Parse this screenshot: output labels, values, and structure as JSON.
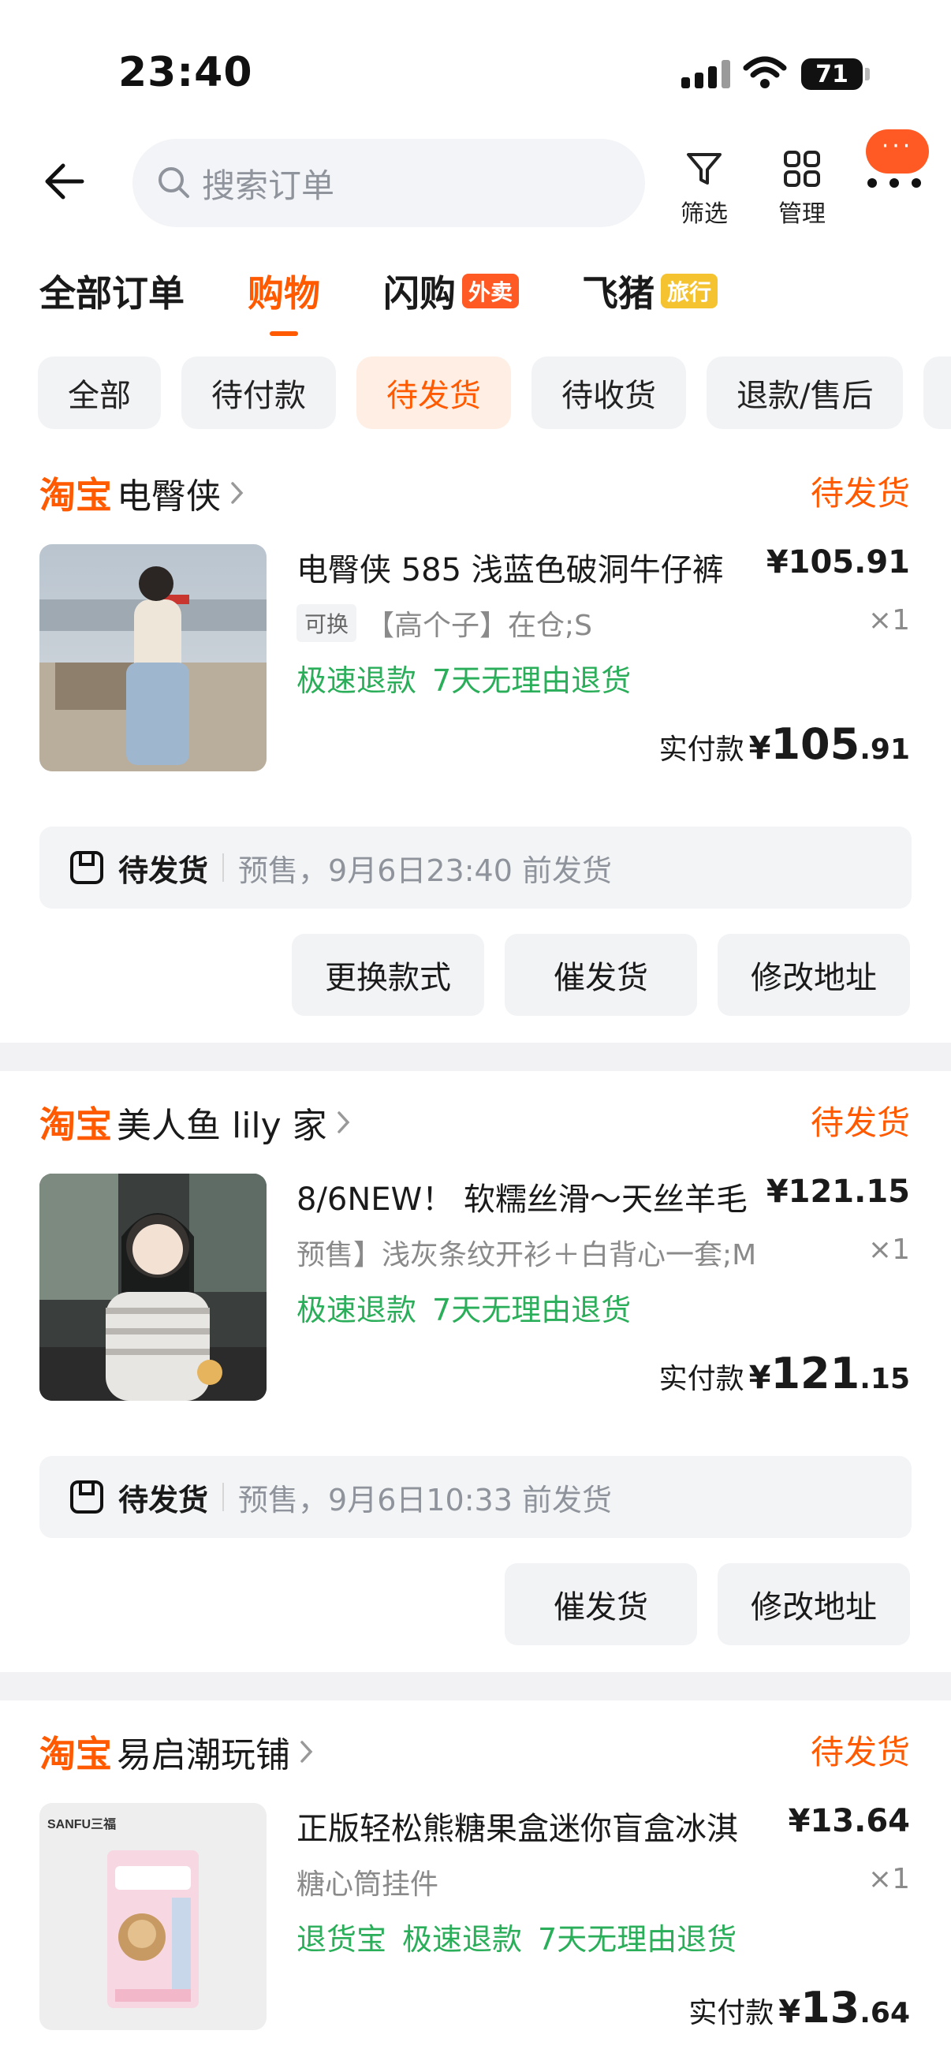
{
  "status_bar": {
    "time": "23:40",
    "battery": "71"
  },
  "header": {
    "search_placeholder": "搜索订单",
    "filter_label": "筛选",
    "manage_label": "管理",
    "more_bubble": "···"
  },
  "tabs": [
    {
      "label": "全部订单",
      "tag": ""
    },
    {
      "label": "购物",
      "tag": ""
    },
    {
      "label": "闪购",
      "tag": "外卖"
    },
    {
      "label": "飞猪",
      "tag": "旅行"
    }
  ],
  "filters": [
    "全部",
    "待付款",
    "待发货",
    "待收货",
    "退款/售后"
  ],
  "active_filter": "待发货",
  "colors": {
    "accent": "#ff5a00",
    "green": "#2aae59"
  },
  "orders": [
    {
      "platform": "淘宝",
      "shop": "电臀侠",
      "status": "待发货",
      "title": "电臀侠 585 浅蓝色破洞牛仔裤",
      "price": "¥105.91",
      "sku_badge": "可换",
      "sku": "【高个子】在仓;S",
      "qty": "×1",
      "benefits": [
        "极速退款",
        "7天无理由退货"
      ],
      "paid_label": "实付款",
      "paid_currency": "¥",
      "paid_int": "105",
      "paid_dec": ".91",
      "ship_status": "待发货",
      "ship_text": "预售，9月6日23:40 前发货",
      "buttons": [
        "更换款式",
        "催发货",
        "修改地址"
      ]
    },
    {
      "platform": "淘宝",
      "shop": "美人鱼 lily 家",
      "status": "待发货",
      "title": "8/6NEW！ 软糯丝滑～天丝羊毛",
      "price": "¥121.15",
      "sku_badge": "",
      "sku": "预售】浅灰条纹开衫＋白背心一套;M",
      "qty": "×1",
      "benefits": [
        "极速退款",
        "7天无理由退货"
      ],
      "paid_label": "实付款",
      "paid_currency": "¥",
      "paid_int": "121",
      "paid_dec": ".15",
      "ship_status": "待发货",
      "ship_text": "预售，9月6日10:33 前发货",
      "buttons": [
        "催发货",
        "修改地址"
      ]
    },
    {
      "platform": "淘宝",
      "shop": "易启潮玩铺",
      "status": "待发货",
      "title": "正版轻松熊糖果盒迷你盲盒冰淇",
      "price": "¥13.64",
      "sku_badge": "",
      "sku": "糖心筒挂件",
      "qty": "×1",
      "benefits": [
        "退货宝",
        "极速退款",
        "7天无理由退货"
      ],
      "paid_label": "实付款",
      "paid_currency": "¥",
      "paid_int": "13",
      "paid_dec": ".64",
      "thumb_brand": "SANFU三福"
    }
  ]
}
